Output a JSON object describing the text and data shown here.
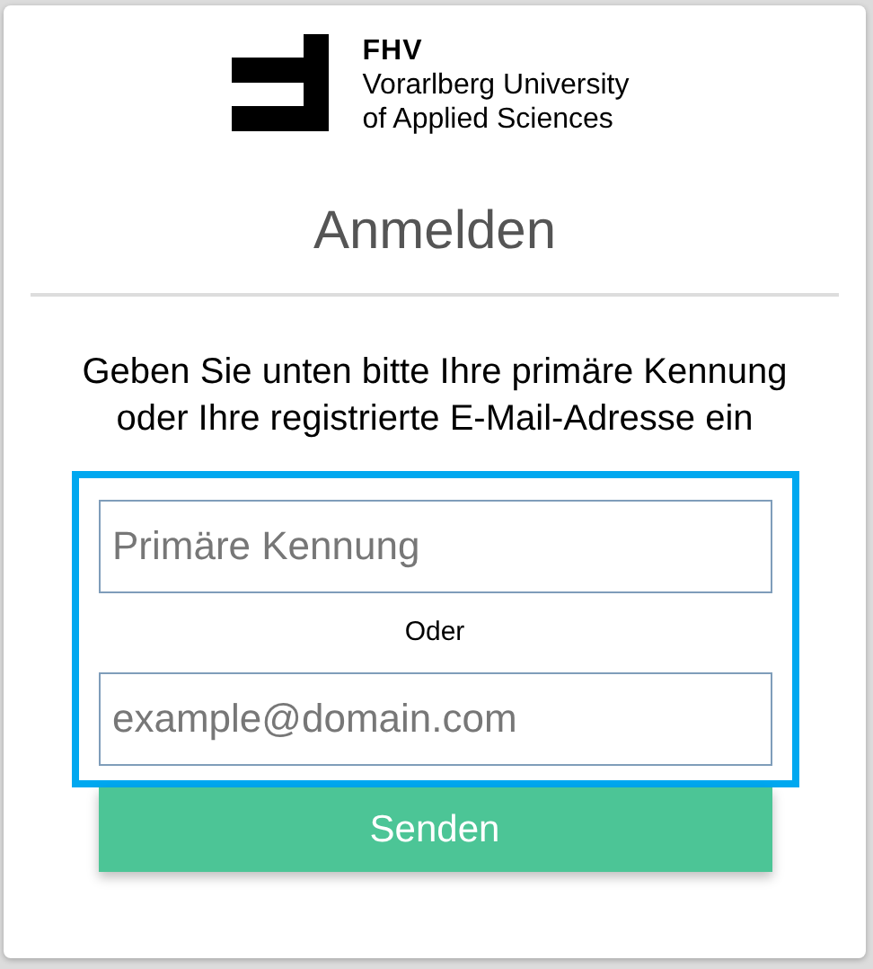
{
  "logo": {
    "name": "FHV",
    "lines": [
      "Vorarlberg University",
      "of Applied Sciences"
    ]
  },
  "title": "Anmelden",
  "instruction": "Geben Sie unten bitte Ihre primäre Kennung oder Ihre registrierte E-Mail-Adresse ein",
  "form": {
    "highlighted": true,
    "fields": [
      {
        "placeholder": "Primäre Kennung"
      },
      {
        "placeholder": "example@domain.com"
      }
    ],
    "separator": "Oder"
  },
  "submit_button": "Senden"
}
